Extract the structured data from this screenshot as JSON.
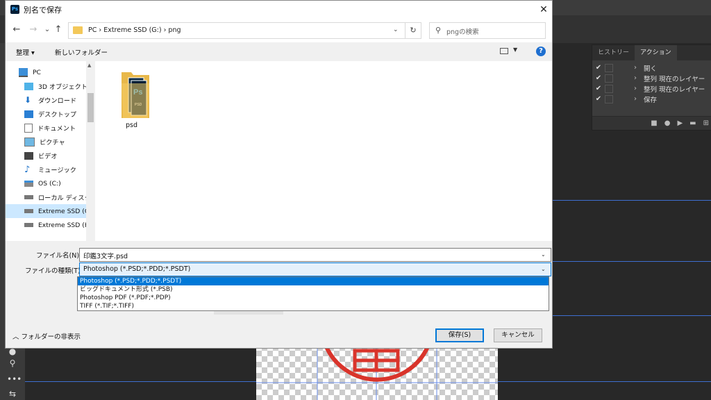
{
  "dialog": {
    "title": "別名で保存",
    "app_badge": "Ps",
    "close_label": "✕"
  },
  "navigation": {
    "back": "←",
    "forward": "→",
    "recent": "⌄",
    "up": "↑",
    "address_path": "PC  ›  Extreme SSD (G:)  ›  png",
    "refresh": "↻",
    "search_placeholder": "pngの検索"
  },
  "toolbar": {
    "organize": "整理 ▾",
    "new_folder": "新しいフォルダー"
  },
  "sidebar": {
    "items": [
      {
        "label": "PC"
      },
      {
        "label": "3D オブジェクト"
      },
      {
        "label": "ダウンロード"
      },
      {
        "label": "デスクトップ"
      },
      {
        "label": "ドキュメント"
      },
      {
        "label": "ピクチャ"
      },
      {
        "label": "ビデオ"
      },
      {
        "label": "ミュージック"
      },
      {
        "label": "OS (C:)"
      },
      {
        "label": "ローカル ディスク (D"
      },
      {
        "label": "Extreme SSD (G:)"
      },
      {
        "label": "Extreme SSD (H:)"
      }
    ]
  },
  "files": [
    {
      "name": "psd"
    }
  ],
  "form": {
    "filename_label": "ファイル名(N):",
    "filename_value": "印鑑3文字.psd",
    "filetype_label": "ファイルの種類(T):",
    "filetype_value": "Photoshop (*.PSD;*.PDD;*.PSDT)",
    "filetype_options": [
      "Photoshop (*.PSD;*.PDD;*.PSDT)",
      "ビッグドキュメント形式 (*.PSB)",
      "Photoshop PDF (*.PDF;*.PDP)",
      "TIFF (*.TIF;*.TIFF)"
    ]
  },
  "footer": {
    "hide_folders": "フォルダーの非表示",
    "save": "保存(S)",
    "cancel": "キャンセル"
  },
  "actions_panel": {
    "tabs": [
      "ヒストリー",
      "アクション"
    ],
    "active_tab": "アクション",
    "rows": [
      {
        "label": "開く"
      },
      {
        "label": "整列  現在のレイヤー"
      },
      {
        "label": "整列  現在のレイヤー"
      },
      {
        "label": "保存"
      }
    ]
  },
  "colors": {
    "accent": "#0078d7",
    "selected": "#cce8ff",
    "stamp_red": "#d9342b",
    "guide": "#3e6fd0"
  }
}
